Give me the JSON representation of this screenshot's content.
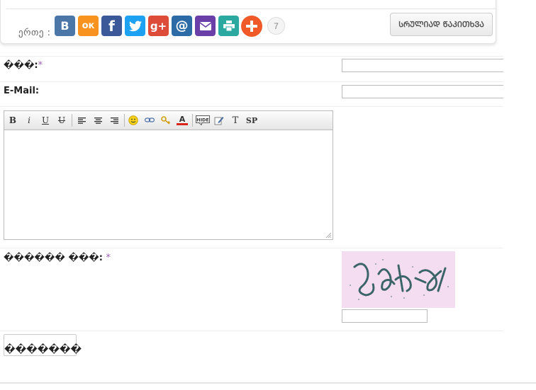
{
  "share": {
    "label": "ერთე :",
    "buttons": [
      {
        "name": "vk",
        "text": "В",
        "color": "#4a76a8"
      },
      {
        "name": "ok",
        "text": "ок",
        "color": "#f7931e"
      },
      {
        "name": "facebook",
        "text": "f",
        "color": "#3b5998"
      },
      {
        "name": "twitter",
        "text": "🐦",
        "color": "#1da1f2"
      },
      {
        "name": "googleplus",
        "text": "g+",
        "color": "#dd4b39"
      },
      {
        "name": "mailru",
        "text": "@",
        "color": "#2d6ba6"
      },
      {
        "name": "email",
        "text": "✉",
        "color": "#6a3fa8"
      },
      {
        "name": "print",
        "text": "⎙",
        "color": "#2ba9a1"
      },
      {
        "name": "more",
        "text": "+",
        "color": "#f05a28"
      }
    ],
    "count": "7",
    "read_all": "ᲡᲠᲣᲚᲘᲐᲓ ᲬᲐᲙᲘᲗᲮᲕᲐ"
  },
  "form": {
    "name_label": "���:",
    "required_mark": "*",
    "email_label": "E-Mail:",
    "captcha_label": "������ ���:",
    "submit_label": "�������"
  },
  "toolbar": {
    "buttons": [
      "bold-icon",
      "italic-icon",
      "underline-icon",
      "strike-icon",
      "align-left-icon",
      "align-center-icon",
      "align-right-icon",
      "smile-icon",
      "link-icon",
      "key-icon",
      "text-color-icon",
      "hide-icon",
      "edit-icon",
      "font-icon",
      "spoiler-icon"
    ],
    "glyphs": {
      "bold": "B",
      "italic": "i",
      "underline": "U",
      "strike": "U",
      "text_color": "A",
      "hide": "HIDE",
      "font": "T",
      "spoiler": "SP"
    }
  }
}
